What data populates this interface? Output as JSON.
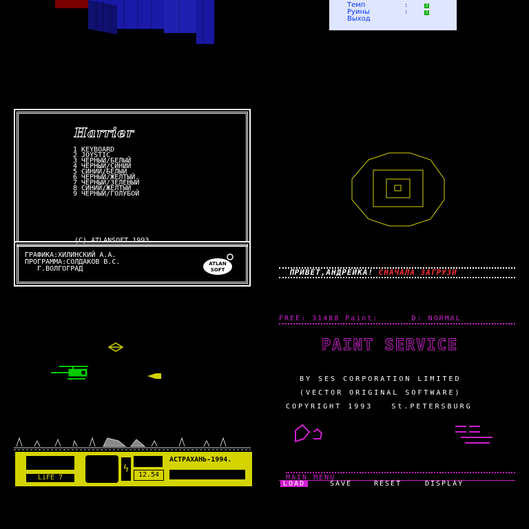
{
  "menu": {
    "items": [
      {
        "label": "Темп",
        "value": "3"
      },
      {
        "label": "Руины",
        "value": "3"
      },
      {
        "label": "Выход",
        "value": ""
      }
    ],
    "colors": {
      "bg": "#dfe6ff",
      "text": "#0033ff",
      "value_bg": "#00aa00"
    }
  },
  "harrier": {
    "title": "Harrier",
    "options": [
      "1 KEYBOARD",
      "2 JOYSTIC",
      "3 ЧЕРНЫЙ/БЕЛЫЙ",
      "4 ЧЕРНЫЙ/СИНИЙ",
      "5 СИНИЙ/БЕЛЫЙ",
      "6 ЧЕРНЫЙ/ЖЕЛТЫЙ",
      "7 ЧЕРНЫЙ/ЗЕЛЕНЫЙ",
      "8 СИНИЙ/ЖЕЛТЫЙ",
      "9 ЧЕРНЫЙ/ГОЛУБОЙ"
    ],
    "copyright": "(C) ATLANSOFT 1993",
    "credits": [
      "ГРАФИКА:ХИЛИНСКИЙ А.А.",
      "ПРОГРАММА:СОЛДАКОВ В.С.",
      "   Г.ВОЛГОГРАД"
    ],
    "logo_text": "ATLAN SOFT"
  },
  "scroller": {
    "part_white": "ПРИВЕТ,АНДРЕЙКА!",
    "part_red": "СНАЧАЛА ЗАГРУЗИ"
  },
  "heli": {
    "life": "LiFE 7",
    "time": "12.54",
    "city": "АСТРАХАНЬ-1994.",
    "colors": {
      "hud": "#d4d400",
      "heli": "#00cc00",
      "enemy": "#d4d400"
    }
  },
  "paint": {
    "status": "FREE: 31488 Paint:      D: NORMAL",
    "title": "PAINT SERVICE",
    "by": "BY SES CORPORATION LIMITED",
    "vector": "(VECTOR ORIGINAL SOFTWARE)",
    "copyright": "COPYRIGHT 1993   St.PETERSBURG",
    "menu_title": "MAIN MENU",
    "menu_items": [
      "LOAD",
      "SAVE",
      "RESET",
      "DISPLAY"
    ],
    "accent": "#d020d0"
  }
}
